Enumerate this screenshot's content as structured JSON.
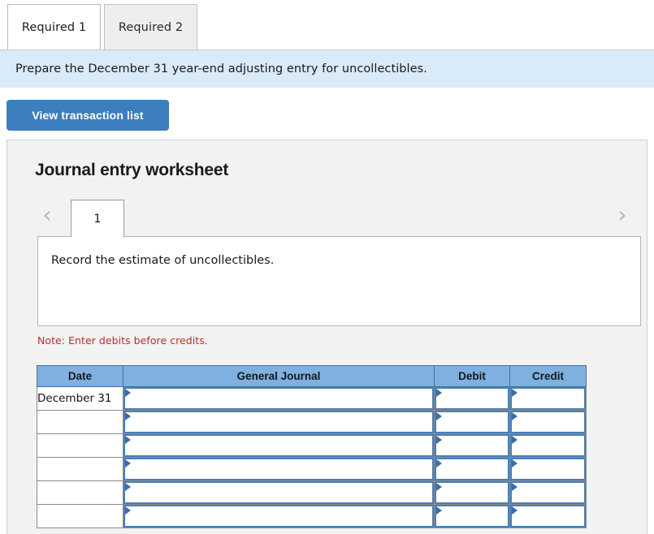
{
  "tabs": [
    {
      "label": "Required 1",
      "active": true
    },
    {
      "label": "Required 2",
      "active": false
    }
  ],
  "banner": {
    "text": "Prepare the December 31 year-end adjusting entry for uncollectibles."
  },
  "toolbar": {
    "view_transaction_list_label": "View transaction list"
  },
  "worksheet": {
    "title": "Journal entry worksheet",
    "prev_icon": "chevron-left-icon",
    "next_icon": "chevron-right-icon",
    "prev_glyph": "‹",
    "next_glyph": "›",
    "entry_tabs": [
      {
        "label": "1",
        "active": true
      }
    ],
    "description": "Record the estimate of uncollectibles.",
    "note": "Note: Enter debits before credits."
  },
  "journal": {
    "columns": [
      "Date",
      "General Journal",
      "Debit",
      "Credit"
    ],
    "rows": [
      {
        "date": "December 31",
        "account": "",
        "debit": "",
        "credit": ""
      },
      {
        "date": "",
        "account": "",
        "debit": "",
        "credit": ""
      },
      {
        "date": "",
        "account": "",
        "debit": "",
        "credit": ""
      },
      {
        "date": "",
        "account": "",
        "debit": "",
        "credit": ""
      },
      {
        "date": "",
        "account": "",
        "debit": "",
        "credit": ""
      },
      {
        "date": "",
        "account": "",
        "debit": "",
        "credit": ""
      }
    ]
  },
  "colors": {
    "accent_blue": "#3c7ebe",
    "banner_blue": "#d9eaf8",
    "header_blue": "#7fb0e0",
    "note_red": "#b3322c",
    "panel_gray": "#f2f2f2",
    "input_border_blue": "#4a7eb5"
  }
}
